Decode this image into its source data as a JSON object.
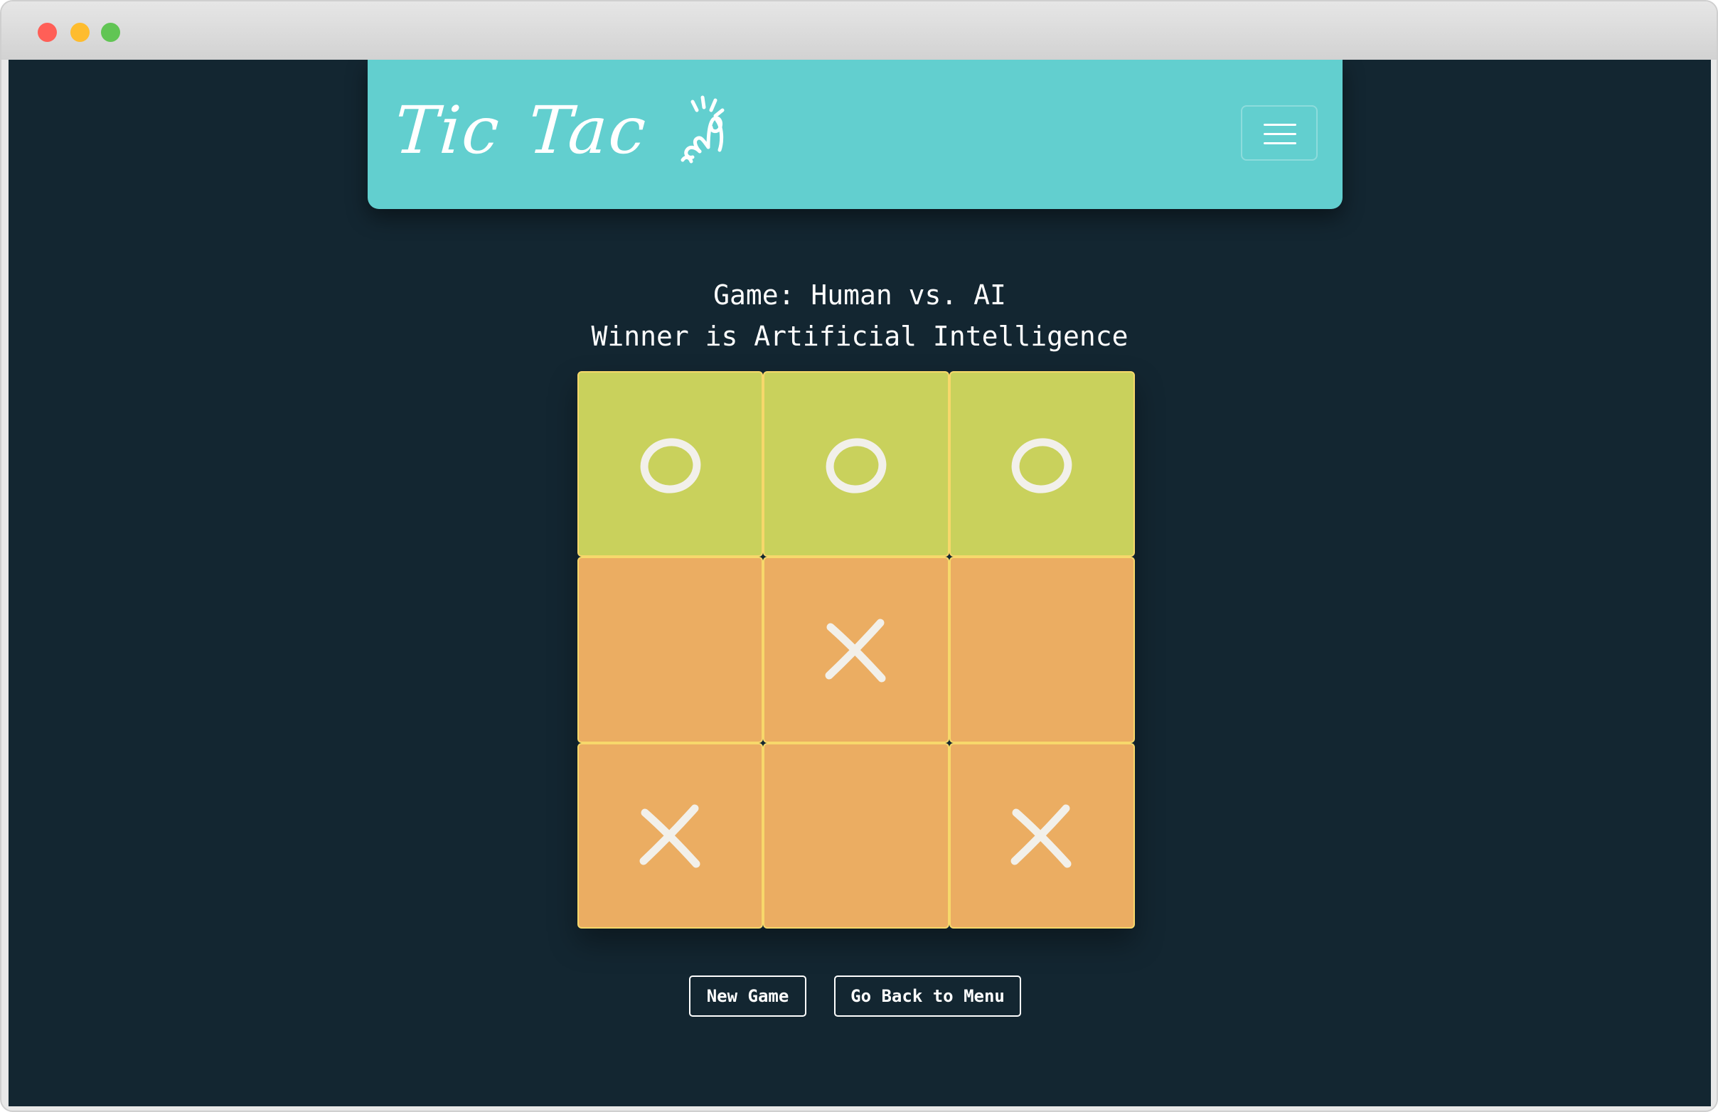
{
  "app": {
    "brand_word_1": "Tic",
    "brand_word_2": "Tac",
    "brand_logo_icon": "hand-pointer-logo-icon",
    "menu_icon": "hamburger-menu-icon"
  },
  "status": {
    "game_line": "Game: Human vs. AI",
    "winner_line": "Winner is Artificial Intelligence"
  },
  "board": {
    "cells": [
      {
        "mark": "O",
        "winning": true
      },
      {
        "mark": "O",
        "winning": true
      },
      {
        "mark": "O",
        "winning": true
      },
      {
        "mark": "",
        "winning": false
      },
      {
        "mark": "X",
        "winning": false
      },
      {
        "mark": "",
        "winning": false
      },
      {
        "mark": "X",
        "winning": false
      },
      {
        "mark": "",
        "winning": false
      },
      {
        "mark": "X",
        "winning": false
      }
    ]
  },
  "buttons": {
    "new_game": "New Game",
    "back_to_menu": "Go Back to Menu"
  },
  "colors": {
    "background": "#132631",
    "navbar": "#62cfcf",
    "winning_cell": "#c9d15c",
    "cell": "#ebad62",
    "cell_border": "#f7d86b",
    "mark": "#f2f0ea"
  }
}
